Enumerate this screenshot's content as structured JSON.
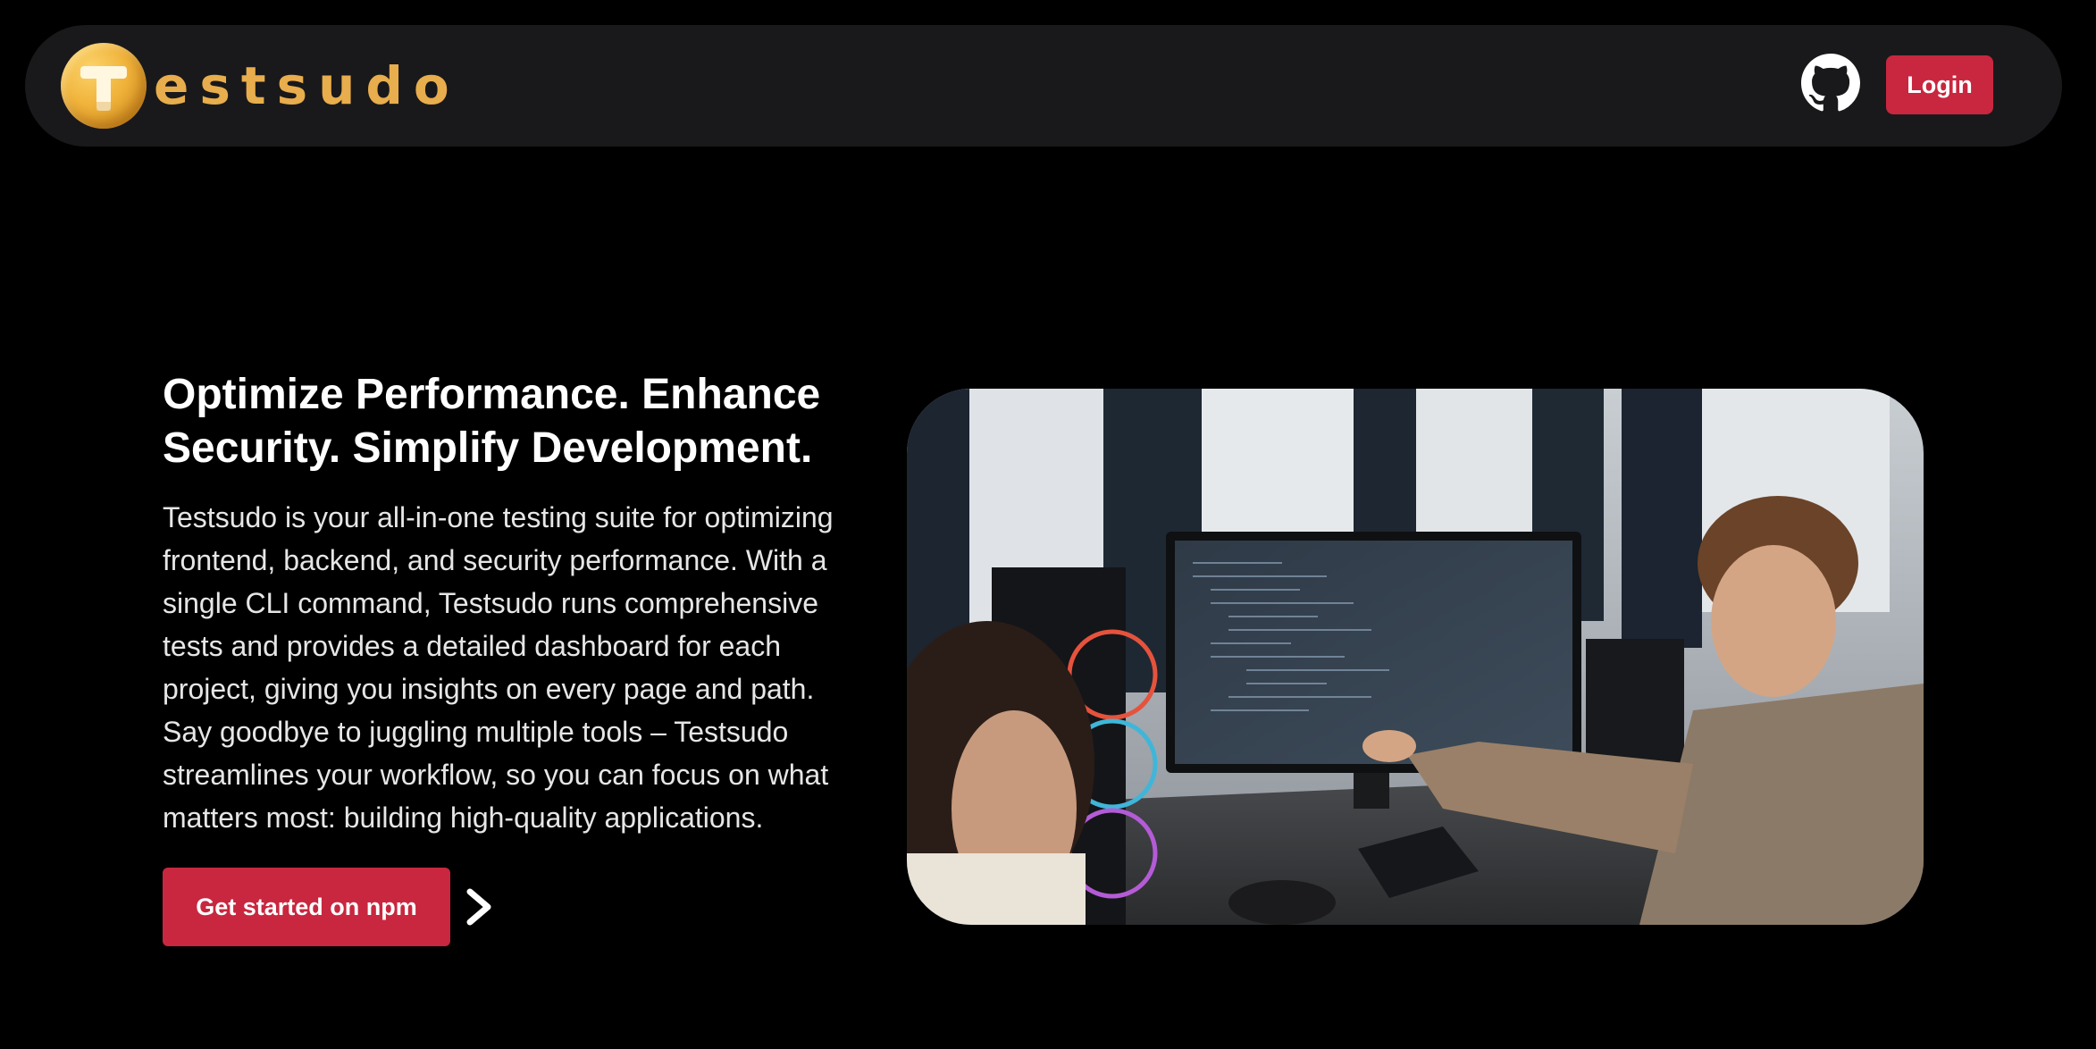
{
  "brand": {
    "logo_letter": "T",
    "name": "estsudo"
  },
  "nav": {
    "github_icon": "github-icon",
    "login_label": "Login"
  },
  "hero": {
    "title": "Optimize Performance. Enhance Security. Simplify Development.",
    "description": "Testsudo is your all-in-one testing suite for optimizing frontend, backend, and security performance. With a single CLI command, Testsudo runs comprehensive tests and provides a detailed dashboard for each project, giving you insights on every page and path. Say goodbye to juggling multiple tools – Testsudo streamlines your workflow, so you can focus on what matters most: building high-quality applications.",
    "cta_label": "Get started on npm",
    "cta_arrow_icon": "chevron-right-icon",
    "image": "photo-two-developers-at-monitor"
  },
  "colors": {
    "background": "#000000",
    "navbar": "#19191b",
    "accent": "#c8273f",
    "brand_gold": "#e8ad4c"
  }
}
